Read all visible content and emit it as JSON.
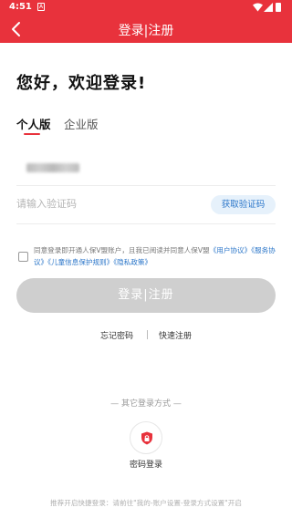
{
  "status_bar": {
    "time": "4:51",
    "notif_glyph": "A"
  },
  "nav": {
    "title": "登录|注册"
  },
  "greeting": "您好，欢迎登录!",
  "tabs": [
    {
      "label": "个人版",
      "selected": true
    },
    {
      "label": "企业版",
      "selected": false
    }
  ],
  "code": {
    "placeholder": "请输入验证码",
    "get_code_label": "获取验证码"
  },
  "agreement": {
    "prefix": "同意登录即开通人保V盟账户，且我已阅读并同意人保V盟",
    "link1": "《用户协议》《服务协议》",
    "link2": "《儿童信息保护规则》",
    "link3": "《隐私政策》"
  },
  "login_button": "登录|注册",
  "links": {
    "forgot": "忘记密码",
    "quick_register": "快速注册"
  },
  "other_methods": {
    "title": "— 其它登录方式 —",
    "password_login": "密码登录"
  },
  "tip": "推荐开启快捷登录：请前往\"我的-账户设置-登录方式设置\"开启",
  "colors": {
    "brand": "#e8323c",
    "link": "#2b76c9",
    "disabled_button": "#cfcfcf"
  }
}
